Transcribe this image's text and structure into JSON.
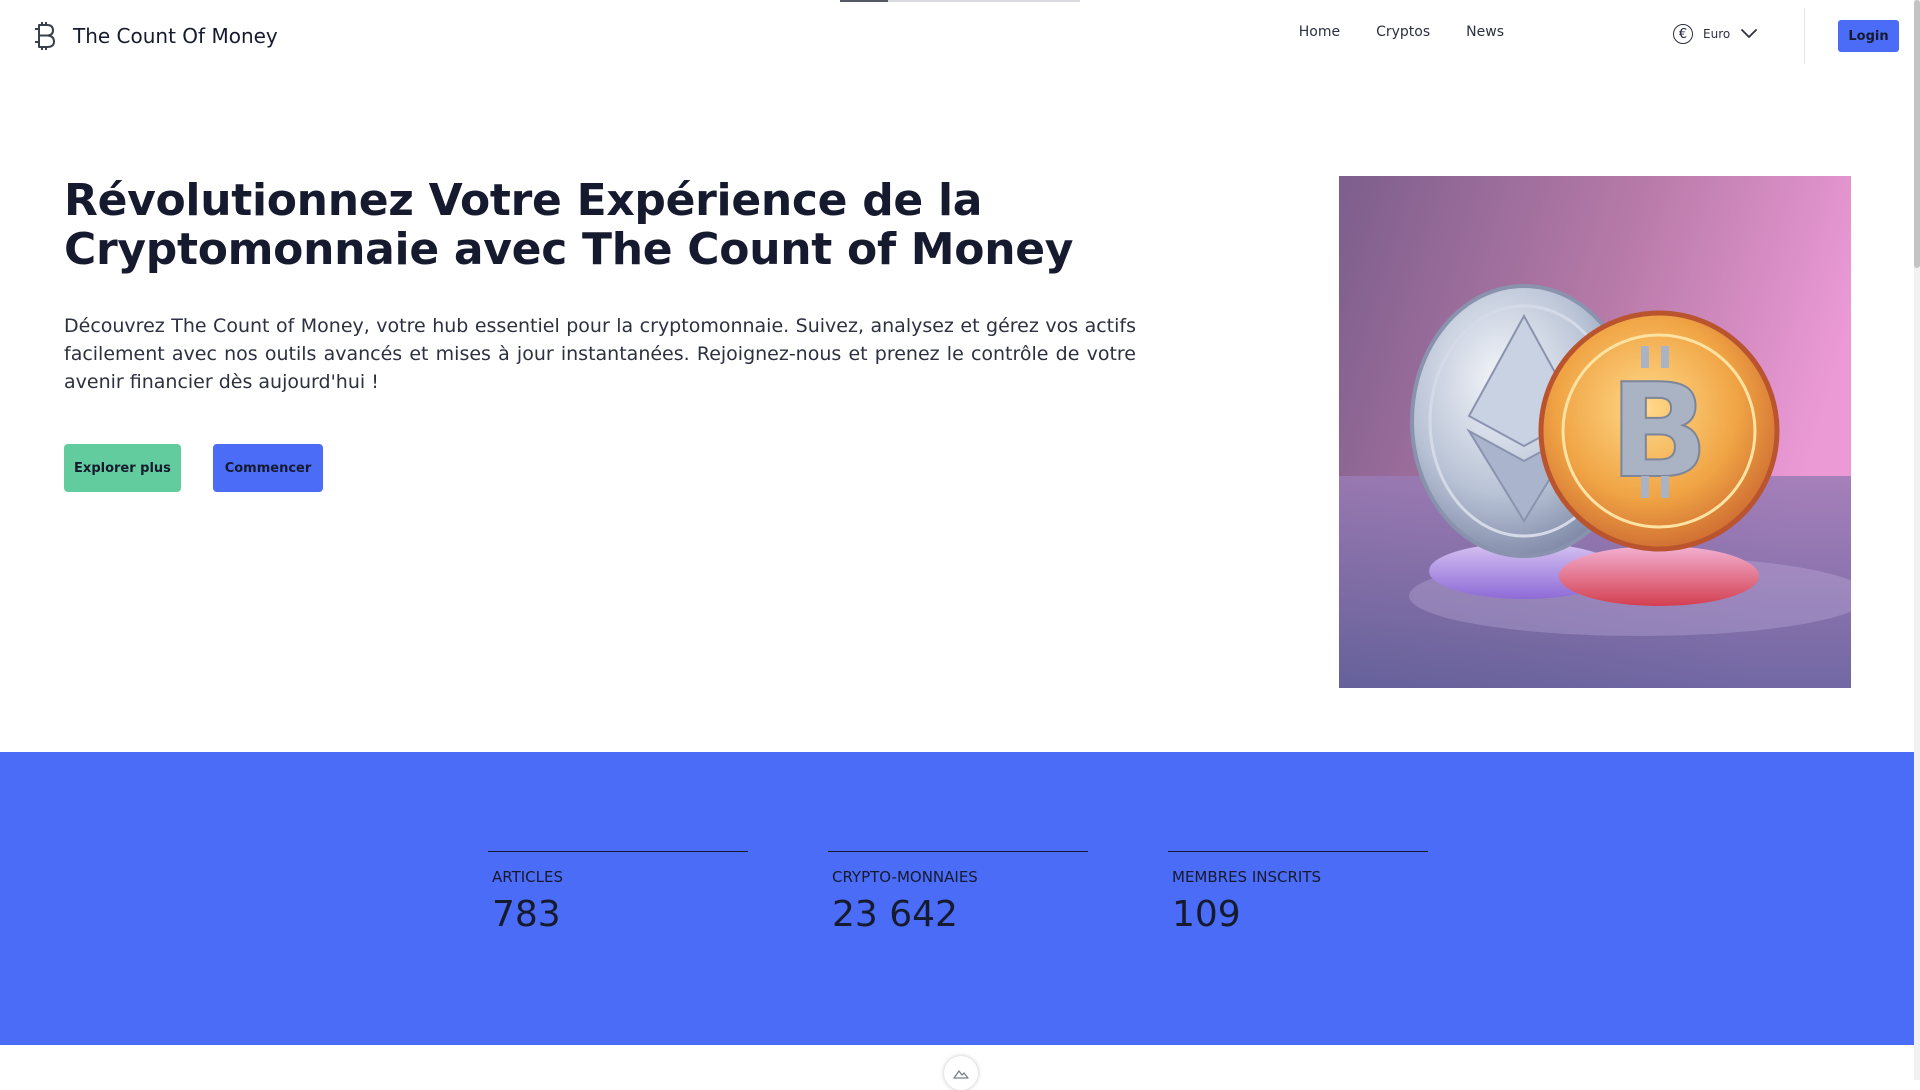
{
  "page": {
    "load_progress": 0.2
  },
  "header": {
    "brand_name": "The Count Of Money",
    "logo_icon": "bitcoin-b-icon",
    "nav": [
      {
        "label": "Home"
      },
      {
        "label": "Cryptos"
      },
      {
        "label": "News"
      }
    ],
    "currency": {
      "icon": "euro-icon",
      "label": "Euro",
      "dropdown_icon": "chevron-down-icon"
    },
    "login_label": "Login"
  },
  "hero": {
    "title": "Révolutionnez Votre Expérience de la Cryptomonnaie avec The Count of Money",
    "description": "Découvrez The Count of Money, votre hub essentiel pour la cryptomonnaie. Suivez, analysez et gérez vos actifs facilement avec nos outils avancés et mises à jour instantanées. Rejoignez-nous et prenez le contrôle de votre avenir financier dès aujourd'hui !",
    "buttons": [
      {
        "label": "Explorer plus"
      },
      {
        "label": "Commencer"
      }
    ],
    "image": {
      "description": "ethereum and bitcoin coins illustration"
    }
  },
  "stats": [
    {
      "label": "ARTICLES",
      "value": "783"
    },
    {
      "label": "CRYPTO-MONNAIES",
      "value": "23 642"
    },
    {
      "label": "MEMBRES INSCRITS",
      "value": "109"
    }
  ],
  "colors": {
    "primary": "#4a6cf7",
    "accent_green": "#63cc9e",
    "text_dark": "#161a2e"
  }
}
